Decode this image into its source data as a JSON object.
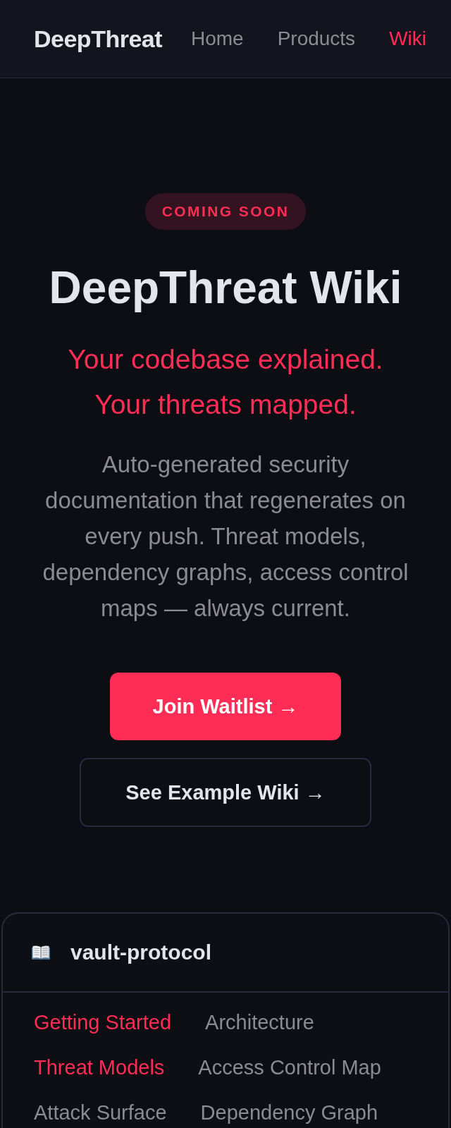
{
  "header": {
    "logo": "DeepThreat",
    "nav": [
      {
        "label": "Home",
        "selected": false
      },
      {
        "label": "Products",
        "selected": false
      },
      {
        "label": "Wiki",
        "selected": true
      }
    ]
  },
  "hero": {
    "badge": "COMING SOON",
    "title": "DeepThreat Wiki",
    "tagline": "Your codebase explained. Your threats mapped.",
    "description": "Auto-generated security documentation that regenerates on every push. Threat models, dependency graphs, access control maps — always current.",
    "buttons": [
      {
        "label": "Join Waitlist →",
        "kind": "primary"
      },
      {
        "label": "See Example Wiki →",
        "kind": "secondary"
      }
    ]
  },
  "wiki_preview": {
    "repo": "vault-protocol",
    "pages": [
      {
        "label": "Getting Started",
        "highlighted": true
      },
      {
        "label": "Architecture",
        "highlighted": false
      },
      {
        "label": "Threat Models",
        "highlighted": true
      },
      {
        "label": "Access Control Map",
        "highlighted": false
      },
      {
        "label": "Attack Surface",
        "highlighted": false
      },
      {
        "label": "Dependency Graph",
        "highlighted": false
      }
    ]
  }
}
